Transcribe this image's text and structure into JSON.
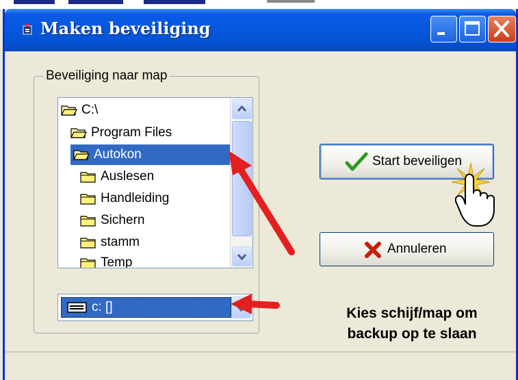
{
  "window": {
    "title": "Maken beveiliging"
  },
  "folder_group": {
    "legend": "Beveiliging naar map",
    "tree_items": [
      {
        "label": "C:\\",
        "icon": "folder-open-icon",
        "selected": false
      },
      {
        "label": "Program Files",
        "icon": "folder-open-icon",
        "selected": false
      },
      {
        "label": "Autokon",
        "icon": "folder-open-icon",
        "selected": true
      },
      {
        "label": "Auslesen",
        "icon": "folder-closed-icon",
        "selected": false
      },
      {
        "label": "Handleiding",
        "icon": "folder-closed-icon",
        "selected": false
      },
      {
        "label": "Sichern",
        "icon": "folder-closed-icon",
        "selected": false
      },
      {
        "label": "stamm",
        "icon": "folder-closed-icon",
        "selected": false
      },
      {
        "label": "Temp",
        "icon": "folder-closed-icon",
        "selected": false
      }
    ],
    "drive_value": "c: []"
  },
  "buttons": {
    "start_label": "Start beveiligen",
    "cancel_label": "Annuleren"
  },
  "hint_text": {
    "line1": "Kies schijf/map om",
    "line2": "backup op te slaan"
  },
  "colors": {
    "title_bar": "#0554d4",
    "selection": "#316ac5",
    "annotation_arrow": "#e41f1f",
    "check_mark": "#2b9a1e",
    "cancel_x": "#c81e0a"
  }
}
